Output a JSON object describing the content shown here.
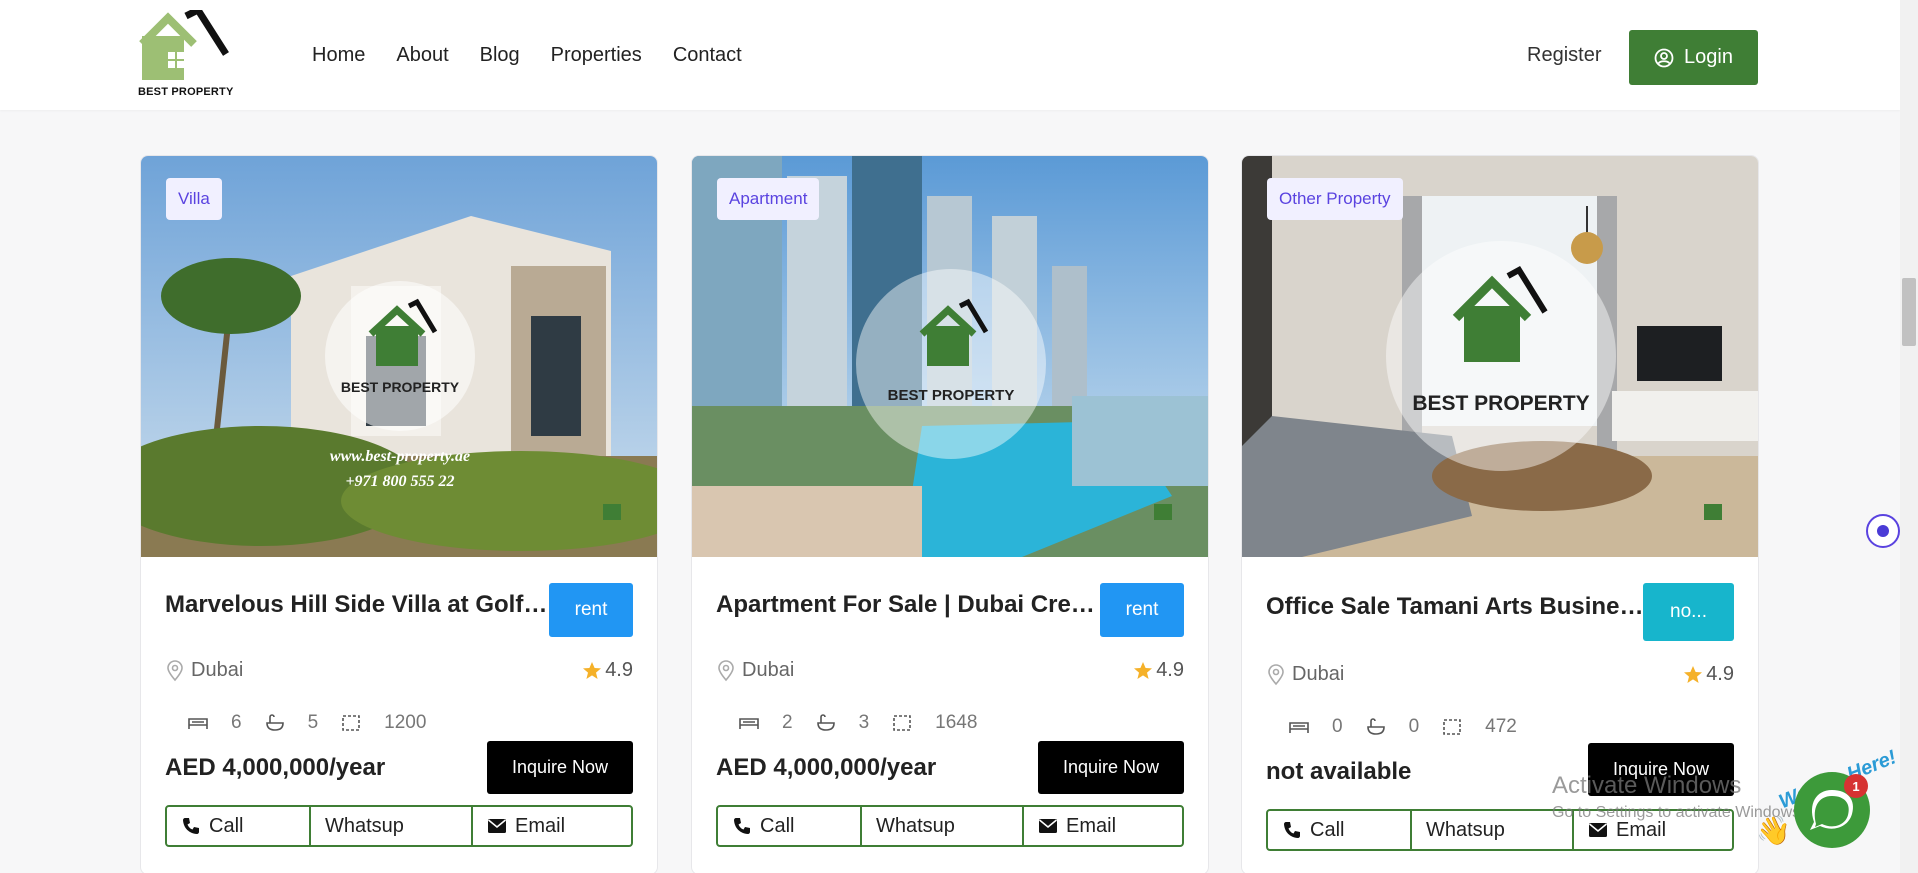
{
  "brand": {
    "name": "BEST PROPERTY"
  },
  "nav": {
    "items": [
      "Home",
      "About",
      "Blog",
      "Properties",
      "Contact"
    ]
  },
  "auth": {
    "register": "Register",
    "login": "Login"
  },
  "watermark": {
    "url": "www.best-property.ae",
    "phone": "+971 800 555 22",
    "brand": "BEST PROPERTY"
  },
  "cards": [
    {
      "category": "Villa",
      "title": "Marvelous Hill Side Villa at Golf Place",
      "status": "rent",
      "location": "Dubai",
      "rating": "4.9",
      "bedrooms": "6",
      "bathrooms": "5",
      "area": "1200",
      "price": "AED 4,000,000/year",
      "inquire": "Inquire Now",
      "call": "Call",
      "whatsapp": "Whatsup",
      "email": "Email"
    },
    {
      "category": "Apartment",
      "title": "Apartment For Sale | Dubai Creek Harbour",
      "status": "rent",
      "location": "Dubai",
      "rating": "4.9",
      "bedrooms": "2",
      "bathrooms": "3",
      "area": "1648",
      "price": "AED 4,000,000/year",
      "inquire": "Inquire Now",
      "call": "Call",
      "whatsapp": "Whatsup",
      "email": "Email"
    },
    {
      "category": "Other Property",
      "title": "Office Sale Tamani Arts Business Bay",
      "status": "no...",
      "location": "Dubai",
      "rating": "4.9",
      "bedrooms": "0",
      "bathrooms": "0",
      "area": "472",
      "price": "not available",
      "inquire": "Inquire Now",
      "call": "Call",
      "whatsapp": "Whatsup",
      "email": "Email"
    }
  ],
  "colors": {
    "brand_green": "#3f7e35",
    "rent_blue": "#2196f3",
    "status_cyan": "#17b5cc",
    "badge_text": "#5a43e0"
  },
  "os_overlay": {
    "line1": "Activate Windows",
    "line2": "Go to Settings to activate Windows."
  },
  "chat_widget": {
    "label": "We Are Here!",
    "count": "1"
  }
}
